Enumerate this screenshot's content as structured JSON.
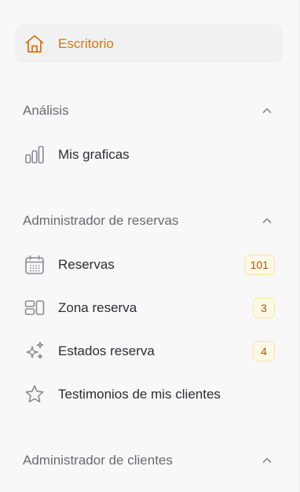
{
  "sidebar": {
    "top_item": {
      "label": "Escritorio",
      "icon": "home-icon",
      "active": true
    },
    "sections": [
      {
        "title": "Análisis",
        "expanded": true,
        "items": [
          {
            "label": "Mis graficas",
            "icon": "bar-chart-icon"
          }
        ]
      },
      {
        "title": "Administrador de reservas",
        "expanded": true,
        "items": [
          {
            "label": "Reservas",
            "icon": "calendar-icon",
            "badge": "101"
          },
          {
            "label": "Zona reserva",
            "icon": "layout-grid-icon",
            "badge": "3"
          },
          {
            "label": "Estados reserva",
            "icon": "sparkles-icon",
            "badge": "4"
          },
          {
            "label": "Testimonios de mis clientes",
            "icon": "star-icon"
          }
        ]
      },
      {
        "title": "Administrador de clientes",
        "expanded": true,
        "items": []
      }
    ]
  },
  "colors": {
    "accent": "#d97706",
    "text": "#2d2d33",
    "muted": "#6b6b73",
    "icon": "#8a8a93",
    "badge_bg": "#fef9e7",
    "badge_border": "#fbe3a7",
    "badge_text": "#b45309",
    "active_bg": "#f1f1f2"
  }
}
